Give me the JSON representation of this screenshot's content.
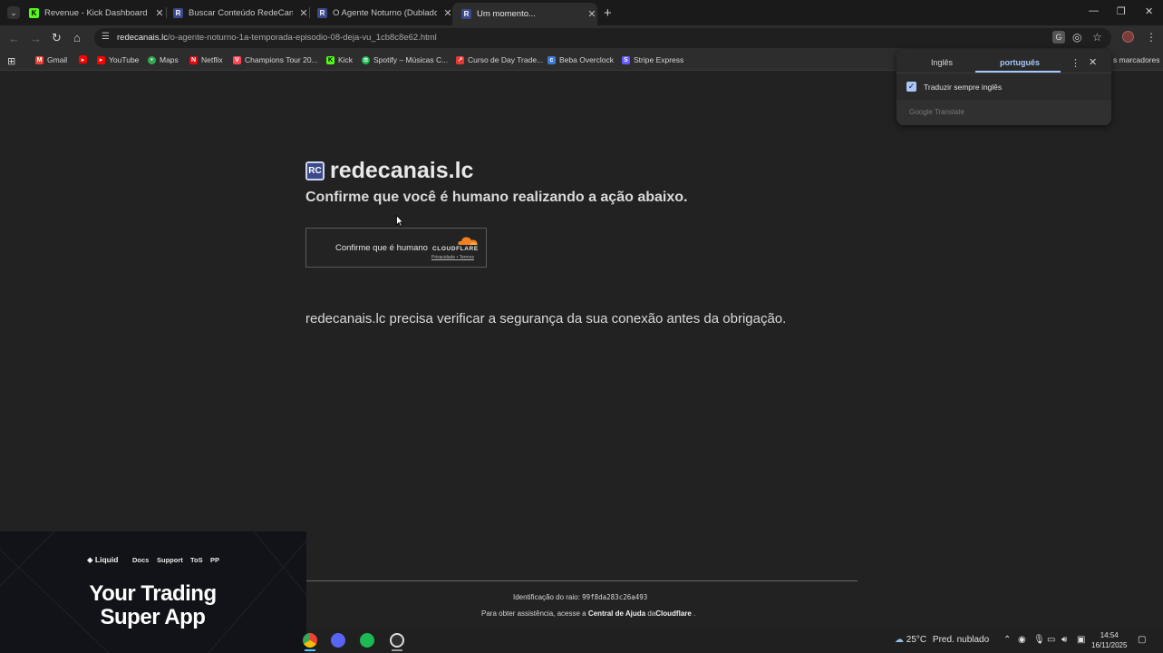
{
  "tabs": [
    {
      "title": "Revenue - Kick Dashboard",
      "icon": "kick-icon",
      "active": false
    },
    {
      "title": "Buscar Conteúdo RedeCanais: o",
      "icon": "redecanais-icon",
      "active": false
    },
    {
      "title": "O Agente Noturno (Dublado)",
      "icon": "redecanais-icon",
      "active": false
    },
    {
      "title": "Um momento...",
      "icon": "redecanais-icon",
      "active": true
    }
  ],
  "address_bar": {
    "host": "redecanais.lc",
    "path": "/o-agente-noturno-1a-temporada-episodio-08-deja-vu_1cb8c8e62.html"
  },
  "bookmarks": [
    {
      "label": "Gmail",
      "icon": "gmail-icon",
      "color": "#ea4335"
    },
    {
      "label": "",
      "icon": "youtube-icon",
      "color": "#ff0000"
    },
    {
      "label": "YouTube",
      "icon": "youtube-icon",
      "color": "#ff0000"
    },
    {
      "label": "Maps",
      "icon": "maps-icon",
      "color": "#34a853"
    },
    {
      "label": "Netflix",
      "icon": "netflix-icon",
      "color": "#e50914"
    },
    {
      "label": "Champions Tour 20...",
      "icon": "valorant-icon",
      "color": "#ff4655"
    },
    {
      "label": "Kick",
      "icon": "kick-icon",
      "color": "#53fc18"
    },
    {
      "label": "Spotify – Músicas C...",
      "icon": "spotify-icon",
      "color": "#1db954"
    },
    {
      "label": "Curso de Day Trade...",
      "icon": "course-icon",
      "color": "#e53935"
    },
    {
      "label": "Beba Overclock",
      "icon": "overclock-icon",
      "color": "#3a7bd5"
    },
    {
      "label": "Stripe Express",
      "icon": "stripe-icon",
      "color": "#635bff"
    }
  ],
  "bookmarks_right": "s marcadores",
  "page": {
    "site_name": "redecanais.lc",
    "headline": "Confirme que você é humano realizando a ação abaixo.",
    "widget": {
      "label": "Confirme que é humano",
      "brand": "CLOUDFLARE",
      "privacy": "Privacidade",
      "sep": "•",
      "terms": "Termos"
    },
    "security_text": "redecanais.lc precisa verificar a segurança da sua conexão antes da obrigação.",
    "ray_label": "Identificação do raio:",
    "ray_id": "99f8da283c26a493",
    "help_prefix": "Para obter assistência, acesse a ",
    "help_link": "Central de Ajuda",
    "help_mid": " da",
    "help_brand": "Cloudflare",
    "help_suffix": " ."
  },
  "translate_popup": {
    "source_tab": "Inglês",
    "target_tab": "português",
    "checkbox_label": "Traduzir sempre inglês",
    "checked": true,
    "brand": "Google Translate"
  },
  "pip_video": {
    "logo": "Liquid",
    "nav": [
      "Docs",
      "Support",
      "ToS",
      "PP"
    ],
    "hero": "Your Trading Super App"
  },
  "taskbar": {
    "weather_temp": "25°C",
    "weather_desc": "Pred. nublado",
    "time": "14:54",
    "date": "16/11/2025"
  }
}
